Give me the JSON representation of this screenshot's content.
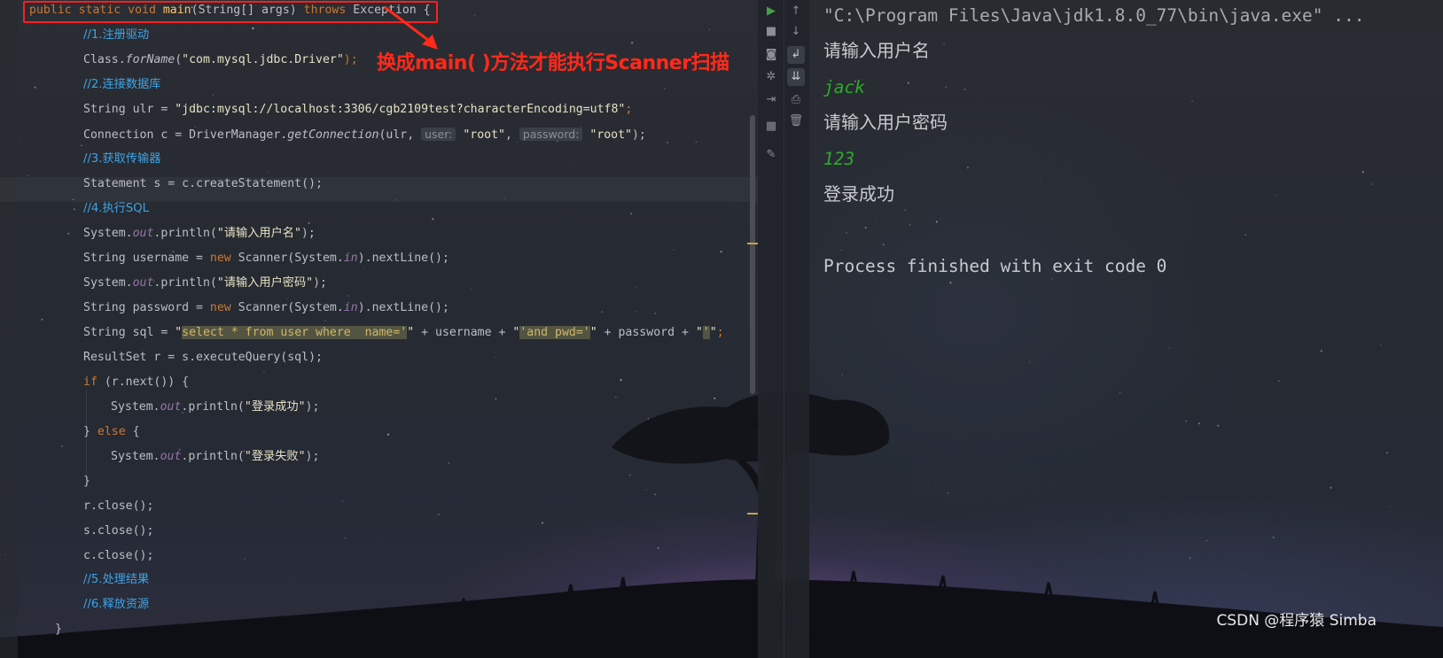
{
  "editor": {
    "lines": {
      "l1": {
        "kw1": "public static void ",
        "method": "main",
        "sig": "(String[] args) ",
        "kw2": "throws",
        "rest": " Exception {"
      },
      "l2": "//1.注册驱动",
      "l3": {
        "a": "Class.",
        "b": "forName",
        "c": "(",
        "s": "\"com.mysql.jdbc.Driver\"",
        "d": ");"
      },
      "l4": "//2.连接数据库",
      "l5": {
        "a": "String ulr = ",
        "s": "\"jdbc:mysql://localhost:3306/cgb2109test?characterEncoding=utf8\"",
        "d": ";"
      },
      "l6": {
        "a": "Connection c = DriverManager.",
        "b": "getConnection",
        "c": "(ulr, ",
        "h1": "user:",
        "s1": " \"root\"",
        "sep": ", ",
        "h2": "password:",
        "s2": " \"root\"",
        "d": ");"
      },
      "l7": "//3.获取传输器",
      "l8": "Statement s = c.createStatement();",
      "l9": "//4.执行SQL",
      "l10": {
        "a": "System.",
        "f": "out",
        "b": ".println(",
        "s": "\"请输入用户名\"",
        "d": ");"
      },
      "l11": {
        "a": "String username = ",
        "kw": "new",
        "b": " Scanner(System.",
        "f": "in",
        "d": ").nextLine();"
      },
      "l12": {
        "a": "System.",
        "f": "out",
        "b": ".println(",
        "s": "\"请输入用户密码\"",
        "d": ");"
      },
      "l13": {
        "a": "String password = ",
        "kw": "new",
        "b": " Scanner(System.",
        "f": "in",
        "d": ").nextLine();"
      },
      "l14": {
        "a": "String sql = ",
        "q1": "\"",
        "h1": "select * from user where  name='",
        "q2": "\"",
        "b": " + username + ",
        "q3": "\"",
        "h2": "'and pwd='",
        "q4": "\"",
        "c": " + password + ",
        "q5": "\"",
        "h3": "'",
        "q6": "\"",
        "d": ";"
      },
      "l15": "ResultSet r = s.executeQuery(sql);",
      "l16": {
        "kw": "if",
        "b": " (r.next()) {"
      },
      "l17": {
        "a": "System.",
        "f": "out",
        "b": ".println(",
        "s": "\"登录成功\"",
        "d": ");"
      },
      "l18": {
        "a": "} ",
        "kw": "else",
        "b": " {"
      },
      "l19": {
        "a": "System.",
        "f": "out",
        "b": ".println(",
        "s": "\"登录失败\"",
        "d": ");"
      },
      "l20": "}",
      "l21": "r.close();",
      "l22": "s.close();",
      "l23": "c.close();",
      "l24": "//5.处理结果",
      "l25": "//6.释放资源",
      "l26": "}"
    },
    "annotation": "换成main( )方法才能执行Scanner扫描"
  },
  "toolbar": {
    "left": [
      "run-icon",
      "stop-icon",
      "camera-icon",
      "debug-icon",
      "login-icon",
      "layout-icon",
      "pin-icon"
    ],
    "right": [
      "up-icon",
      "down-icon",
      "soft-wrap-icon",
      "scroll-end-icon",
      "print-icon",
      "trash-icon"
    ]
  },
  "console": {
    "command": "\"C:\\Program Files\\Java\\jdk1.8.0_77\\bin\\java.exe\" ...",
    "prompt_user": "请输入用户名",
    "input_user": "jack",
    "prompt_pass": "请输入用户密码",
    "input_pass": "123",
    "result": "登录成功",
    "exit": "Process finished with exit code 0"
  },
  "watermark": "CSDN @程序猿   Simba",
  "colors": {
    "keyword": "#cc7832",
    "comment": "#3ea4e8",
    "method": "#ffc66d",
    "highlight": "#ff1e1e",
    "console_input": "#2fa82f"
  }
}
